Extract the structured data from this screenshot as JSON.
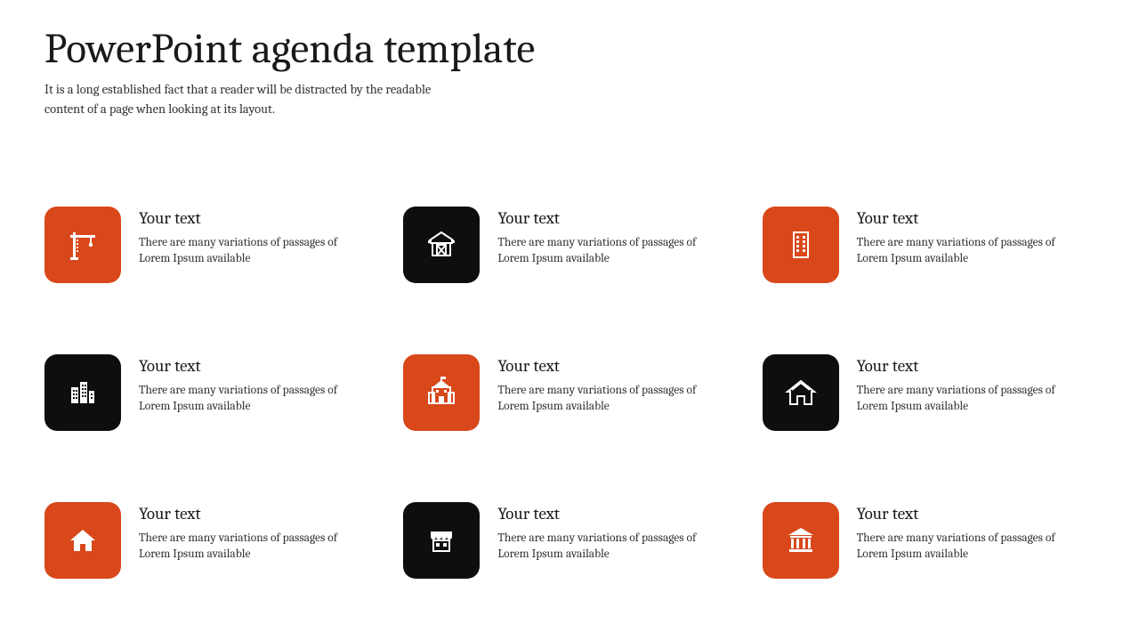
{
  "header": {
    "title": "PowerPoint agenda template",
    "subtitle": "It is a long established fact that a reader will be distracted by the readable content of a page when looking at its layout."
  },
  "colors": {
    "orange": "#d8481a",
    "black": "#0e0e0e"
  },
  "items": [
    {
      "title": "Your text",
      "desc": "There are many variations of passages of Lorem Ipsum available",
      "tile_color": "orange",
      "icon": "crane-icon"
    },
    {
      "title": "Your text",
      "desc": "There are many variations of passages of Lorem Ipsum available",
      "tile_color": "black",
      "icon": "barn-icon"
    },
    {
      "title": "Your text",
      "desc": "There are many variations of passages of Lorem Ipsum available",
      "tile_color": "orange",
      "icon": "office-building-icon"
    },
    {
      "title": "Your text",
      "desc": "There are many variations of passages of Lorem Ipsum available",
      "tile_color": "black",
      "icon": "city-buildings-icon"
    },
    {
      "title": "Your text",
      "desc": "There are many variations of passages of Lorem Ipsum available",
      "tile_color": "orange",
      "icon": "school-building-icon"
    },
    {
      "title": "Your text",
      "desc": "There are many variations of passages of Lorem Ipsum available",
      "tile_color": "black",
      "icon": "house-icon"
    },
    {
      "title": "Your text",
      "desc": "There are many variations of passages of Lorem Ipsum available",
      "tile_color": "orange",
      "icon": "home-icon"
    },
    {
      "title": "Your text",
      "desc": "There are many variations of passages of Lorem Ipsum available",
      "tile_color": "black",
      "icon": "store-icon"
    },
    {
      "title": "Your text",
      "desc": "There are many variations of passages of Lorem Ipsum available",
      "tile_color": "orange",
      "icon": "bank-icon"
    }
  ]
}
